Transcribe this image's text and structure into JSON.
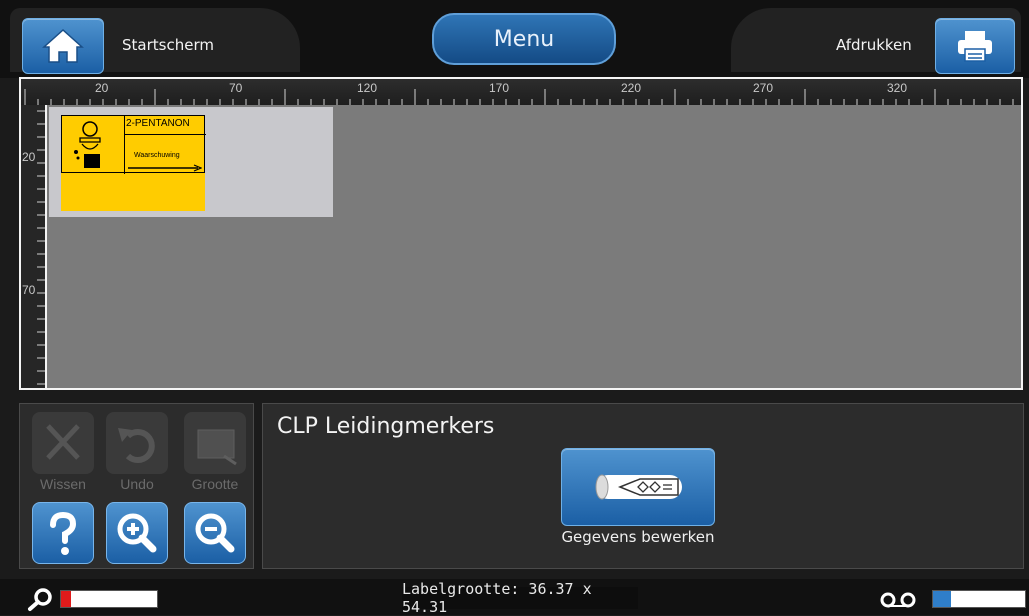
{
  "header": {
    "home_label": "Startscherm",
    "menu_label": "Menu",
    "print_label": "Afdrukken"
  },
  "ruler": {
    "top_ticks": [
      "20",
      "70",
      "120",
      "170",
      "220",
      "270",
      "320"
    ],
    "left_ticks": [
      "20",
      "70"
    ]
  },
  "label_preview": {
    "title": "2-PENTANON",
    "subtitle": "Waarschuwing",
    "background_color": "#ffcc00"
  },
  "tools": {
    "delete_label": "Wissen",
    "undo_label": "Undo",
    "resize_label": "Grootte"
  },
  "panel": {
    "title": "CLP Leidingmerkers",
    "edit_label": "Gegevens bewerken"
  },
  "status": {
    "label_size": "Labelgrootte: 36.37 x 54.31",
    "left_meter_color": "#e01b1b",
    "right_meter_color": "#2f7ec9"
  },
  "colors": {
    "accent": "#1b5fa5",
    "background": "#1b1b1b"
  }
}
